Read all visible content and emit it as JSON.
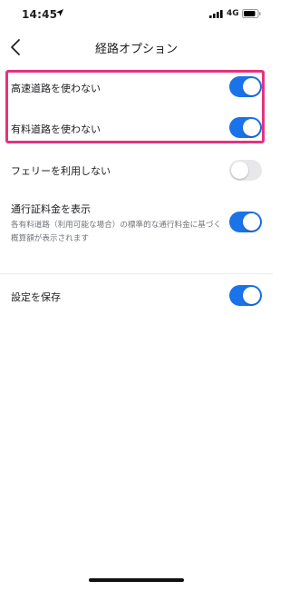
{
  "status_bar": {
    "time": "14:45",
    "location_icon": "location-arrow-icon",
    "signal_icon": "cellular-signal-icon",
    "network": "4G",
    "battery_icon": "battery-icon"
  },
  "header": {
    "back_icon": "chevron-left-icon",
    "title": "経路オプション"
  },
  "options": [
    {
      "label": "高速道路を使わない",
      "enabled": true
    },
    {
      "label": "有料道路を使わない",
      "enabled": true
    },
    {
      "label": "フェリーを利用しない",
      "enabled": false
    },
    {
      "label": "通行証料金を表示",
      "description": "各有料道路（利用可能な場合）の標準的な通行料金に基づく概算額が表示されます",
      "enabled": true
    }
  ],
  "save_setting": {
    "label": "設定を保存",
    "enabled": true
  },
  "colors": {
    "accent": "#1a73e8",
    "highlight_border": "#e4337e",
    "toggle_off": "#e8e8ea"
  }
}
